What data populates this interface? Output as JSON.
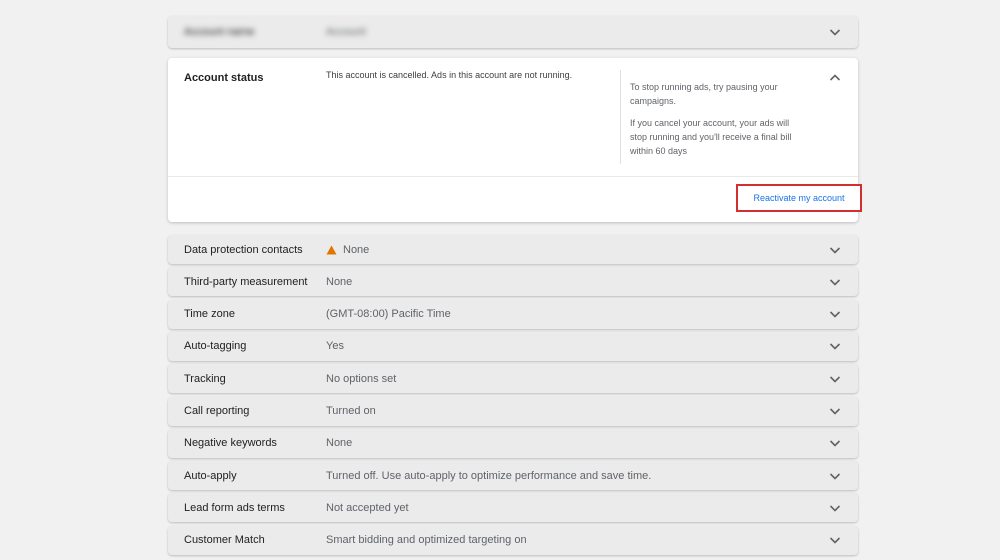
{
  "top_row": {
    "label": "Account name",
    "value": "Account"
  },
  "account_status": {
    "title": "Account status",
    "message": "This account is cancelled. Ads in this account are not running.",
    "help_1": "To stop running ads, try pausing your campaigns.",
    "help_2": "If you cancel your account, your ads will stop running and you'll receive a final bill within 60 days",
    "reactivate_label": "Reactivate my account"
  },
  "rows": [
    {
      "label": "Data protection contacts",
      "value": "None",
      "icon": "warning-icon"
    },
    {
      "label": "Third-party measurement",
      "value": "None"
    },
    {
      "label": "Time zone",
      "value": "(GMT-08:00) Pacific Time"
    },
    {
      "label": "Auto-tagging",
      "value": "Yes"
    },
    {
      "label": "Tracking",
      "value": "No options set"
    },
    {
      "label": "Call reporting",
      "value": "Turned on"
    },
    {
      "label": "Negative keywords",
      "value": "None"
    },
    {
      "label": "Auto-apply",
      "value": "Turned off. Use auto-apply to optimize performance and save time."
    },
    {
      "label": "Lead form ads terms",
      "value": "Not accepted yet"
    },
    {
      "label": "Customer Match",
      "value": "Smart bidding and optimized targeting on"
    }
  ],
  "colors": {
    "warning": "#e37400",
    "link": "#1a73e8",
    "highlight": "#d32f2f"
  }
}
